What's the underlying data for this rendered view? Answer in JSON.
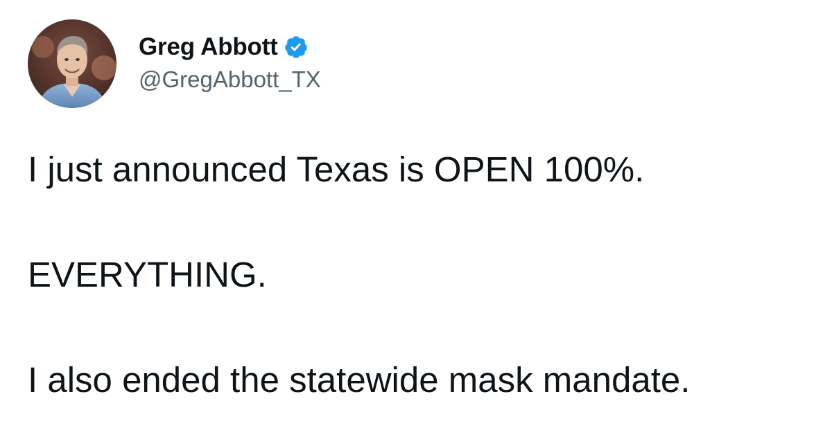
{
  "author": {
    "display_name": "Greg Abbott",
    "handle": "@GregAbbott_TX",
    "verified": true,
    "avatar_icon": "profile-photo",
    "verified_icon": "verified-badge-icon"
  },
  "tweet": {
    "paragraphs": [
      "I just announced Texas is OPEN 100%.",
      "EVERYTHING.",
      "I also ended the statewide mask mandate."
    ]
  },
  "colors": {
    "text": "#0f1419",
    "secondary_text": "#536471",
    "verified_blue": "#1d9bf0",
    "background": "#ffffff"
  }
}
